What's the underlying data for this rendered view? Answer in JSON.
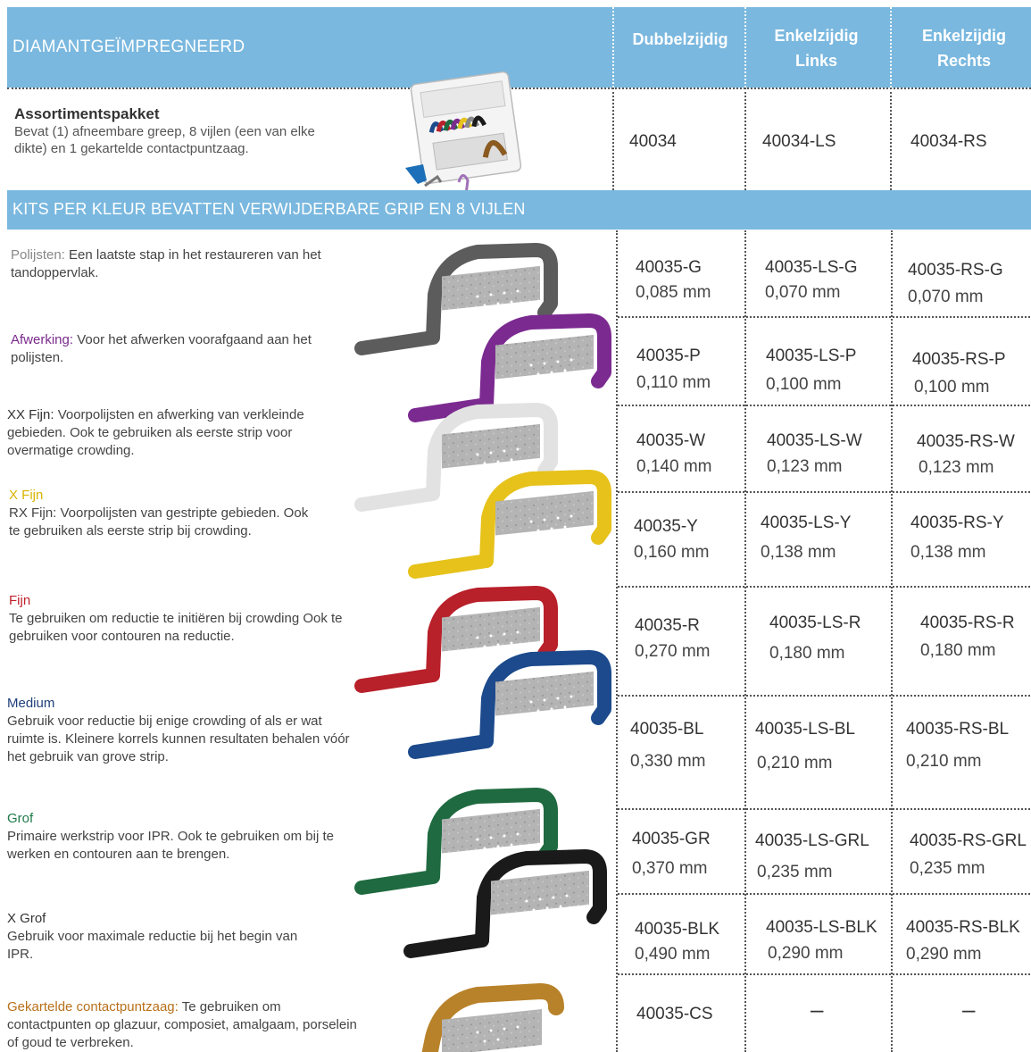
{
  "header": {
    "title": "DIAMANTGEÏMPREGNEERD",
    "col_double": "Dubbelzijdig",
    "col_left": [
      "Enkelzijdig",
      "Links"
    ],
    "col_right": [
      "Enkelzijdig",
      "Rechts"
    ]
  },
  "assortment": {
    "title": "Assortimentspakket",
    "desc": "Bevat (1) afneembare greep, 8 vijlen (een van elke dikte) en 1 gekartelde contactpuntzaag.",
    "double": "40034",
    "left": "40034-LS",
    "right": "40034-RS"
  },
  "band": {
    "text": "KITS PER KLEUR BEVATTEN VERWIJDERBARE GRIP EN 8 VIJLEN"
  },
  "grades": [
    {
      "label": "Polijsten:",
      "label_color": "#888888",
      "desc": "Een laatste stap in het restaureren van het tandoppervlak.",
      "grip_color": "#5c5c5c",
      "double": "40035-G",
      "double_mm": "0,085 mm",
      "left": "40035-LS-G",
      "left_mm": "0,070 mm",
      "right": "40035-RS-G",
      "right_mm": "0,070 mm"
    },
    {
      "label": "Afwerking:",
      "label_color": "#7a2a8c",
      "desc": "Voor het afwerken voorafgaand aan het polijsten.",
      "grip_color": "#7b2a90",
      "double": "40035-P",
      "double_mm": "0,110 mm",
      "left": "40035-LS-P",
      "left_mm": "0,100 mm",
      "right": "40035-RS-P",
      "right_mm": "0,100 mm"
    },
    {
      "label": "XX Fijn:",
      "label_color": "#333333",
      "desc": "Voorpolijsten en afwerking van verkleinde gebieden. Ook te gebruiken als eerste strip voor overmatige crowding.",
      "grip_color": "#e2e2e2",
      "double": "40035-W",
      "double_mm": "0,140 mm",
      "left": "40035-LS-W",
      "left_mm": "0,123 mm",
      "right": "40035-RS-W",
      "right_mm": "0,123 mm"
    },
    {
      "label": "X Fijn",
      "label_color": "#d9b400",
      "desc": "RX Fijn: Voorpolijsten van gestripte gebieden. Ook te gebruiken als eerste strip bij crowding.",
      "grip_color": "#e6c21a",
      "double": "40035-Y",
      "double_mm": "0,160 mm",
      "left": "40035-LS-Y",
      "left_mm": "0,138 mm",
      "right": "40035-RS-Y",
      "right_mm": "0,138 mm"
    },
    {
      "label": "Fijn",
      "label_color": "#c0202a",
      "desc": "Te gebruiken om reductie te initiëren bij crowding Ook te gebruiken voor contouren na reductie.",
      "grip_color": "#b8202a",
      "double": "40035-R",
      "double_mm": "0,270 mm",
      "left": "40035-LS-R",
      "left_mm": "0,180 mm",
      "right": "40035-RS-R",
      "right_mm": "0,180 mm"
    },
    {
      "label": "Medium",
      "label_color": "#1f3f7a",
      "desc": "Gebruik voor reductie bij enige crowding of als er wat ruimte is. Kleinere korrels kunnen resultaten behalen vóór het gebruik van grove strip.",
      "grip_color": "#1c4a8c",
      "double": "40035-BL",
      "double_mm": "0,330 mm",
      "left": "40035-LS-BL",
      "left_mm": "0,210 mm",
      "right": "40035-RS-BL",
      "right_mm": "0,210 mm"
    },
    {
      "label": "Grof",
      "label_color": "#1e7a4a",
      "desc": "Primaire werkstrip voor IPR. Ook te gebruiken om bij te werken en contouren aan te brengen.",
      "grip_color": "#1f6a40",
      "double": "40035-GR",
      "double_mm": "0,370 mm",
      "left": "40035-LS-GRL",
      "left_mm": "0,235 mm",
      "right": "40035-RS-GRL",
      "right_mm": "0,235 mm"
    },
    {
      "label": "X Grof",
      "label_color": "#333333",
      "desc": "Gebruik voor maximale reductie bij het begin van IPR.",
      "grip_color": "#1a1a1a",
      "double": "40035-BLK",
      "double_mm": "0,490 mm",
      "left": "40035-LS-BLK",
      "left_mm": "0,290 mm",
      "right": "40035-RS-BLK",
      "right_mm": "0,290 mm"
    }
  ],
  "saw": {
    "label": "Gekartelde contactpuntzaag:",
    "label_color": "#b8701a",
    "desc": "Te gebruiken om contactpunten op glazuur, composiet, amalgaam, porselein of goud te verbreken.",
    "grip_color": "#b8822a",
    "double": "40035-CS",
    "left": "–",
    "right": "–"
  },
  "colors": {
    "header_blue": "#7ab8df"
  }
}
